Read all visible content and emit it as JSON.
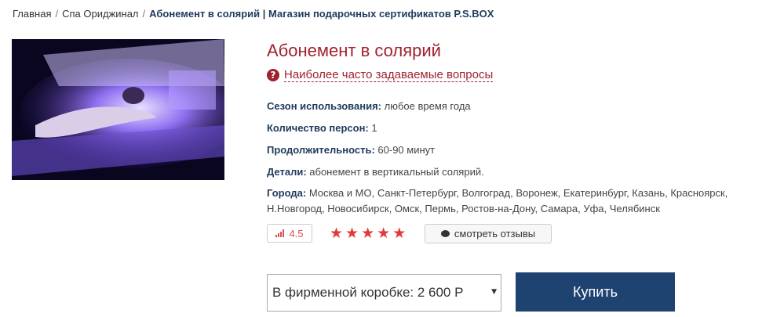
{
  "breadcrumb": {
    "items": [
      "Главная",
      "Спа Ориджинал"
    ],
    "current": "Абонемент в солярий | Магазин подарочных сертификатов P.S.BOX",
    "separator": "/"
  },
  "product": {
    "title": "Абонемент в солярий",
    "faq_link": "Наиболее часто задаваемые вопросы",
    "faq_icon": "?",
    "specs": {
      "season_label": "Сезон использования:",
      "season_value": "любое время года",
      "persons_label": "Количество персон:",
      "persons_value": "1",
      "duration_label": "Продолжительность:",
      "duration_value": "60-90 минут",
      "details_label": "Детали:",
      "details_value": "абонемент в вертикальный солярий.",
      "cities_label": "Города:",
      "cities_value": "Москва и МО, Санкт-Петербург, Волгоград, Воронеж, Екатеринбург, Казань, Красноярск, Н.Новгород, Новосибирск, Омск, Пермь, Ростов-на-Дону, Самара, Уфа, Челябинск"
    },
    "rating": "4.5",
    "stars": 5,
    "reviews_button": "смотреть отзывы"
  },
  "purchase": {
    "option_selected": "В фирменной коробке: 2 600 Р",
    "buy_label": "Купить"
  },
  "colors": {
    "accent": "#a0222f",
    "button": "#1f4370",
    "stars": "#e03a3a"
  }
}
